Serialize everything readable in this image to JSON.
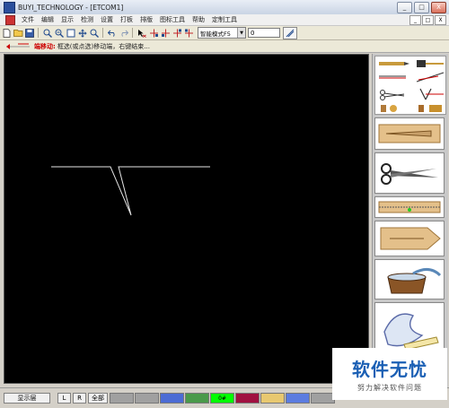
{
  "window": {
    "title": "BUYI_TECHNOLOGY - [ETCOM1]",
    "buttons": [
      "_",
      "□",
      "X"
    ]
  },
  "menubar": {
    "items": [
      "文件",
      "编辑",
      "显示",
      "检测",
      "设置",
      "打板",
      "排版",
      "图标工具",
      "帮助",
      "定制工具"
    ],
    "mdi_buttons": [
      "_",
      "□",
      "X"
    ]
  },
  "toolbar": {
    "mode_value": "智能模式F5",
    "number_value": "0"
  },
  "hint": {
    "label": "端移动:",
    "text": "框选(或点选)移动端，右键结束..."
  },
  "bottombar": {
    "layer_button": "显示层",
    "l_button": "L",
    "r_button": "R",
    "all_button": "全部",
    "swatches": [
      {
        "color": "#a0a0a0",
        "label": ""
      },
      {
        "color": "#a0a0a0",
        "label": ""
      },
      {
        "color": "#4c6cd4",
        "label": ""
      },
      {
        "color": "#4a9a4a",
        "label": ""
      },
      {
        "color": "#00ff00",
        "label": "0#"
      },
      {
        "color": "#a01040",
        "label": ""
      },
      {
        "color": "#e8c870",
        "label": ""
      },
      {
        "color": "#5c7ce0",
        "label": ""
      },
      {
        "color": "#a0a0a0",
        "label": ""
      }
    ]
  },
  "watermark": {
    "main": "软件无忧",
    "sub": "努力解决软件问题"
  }
}
